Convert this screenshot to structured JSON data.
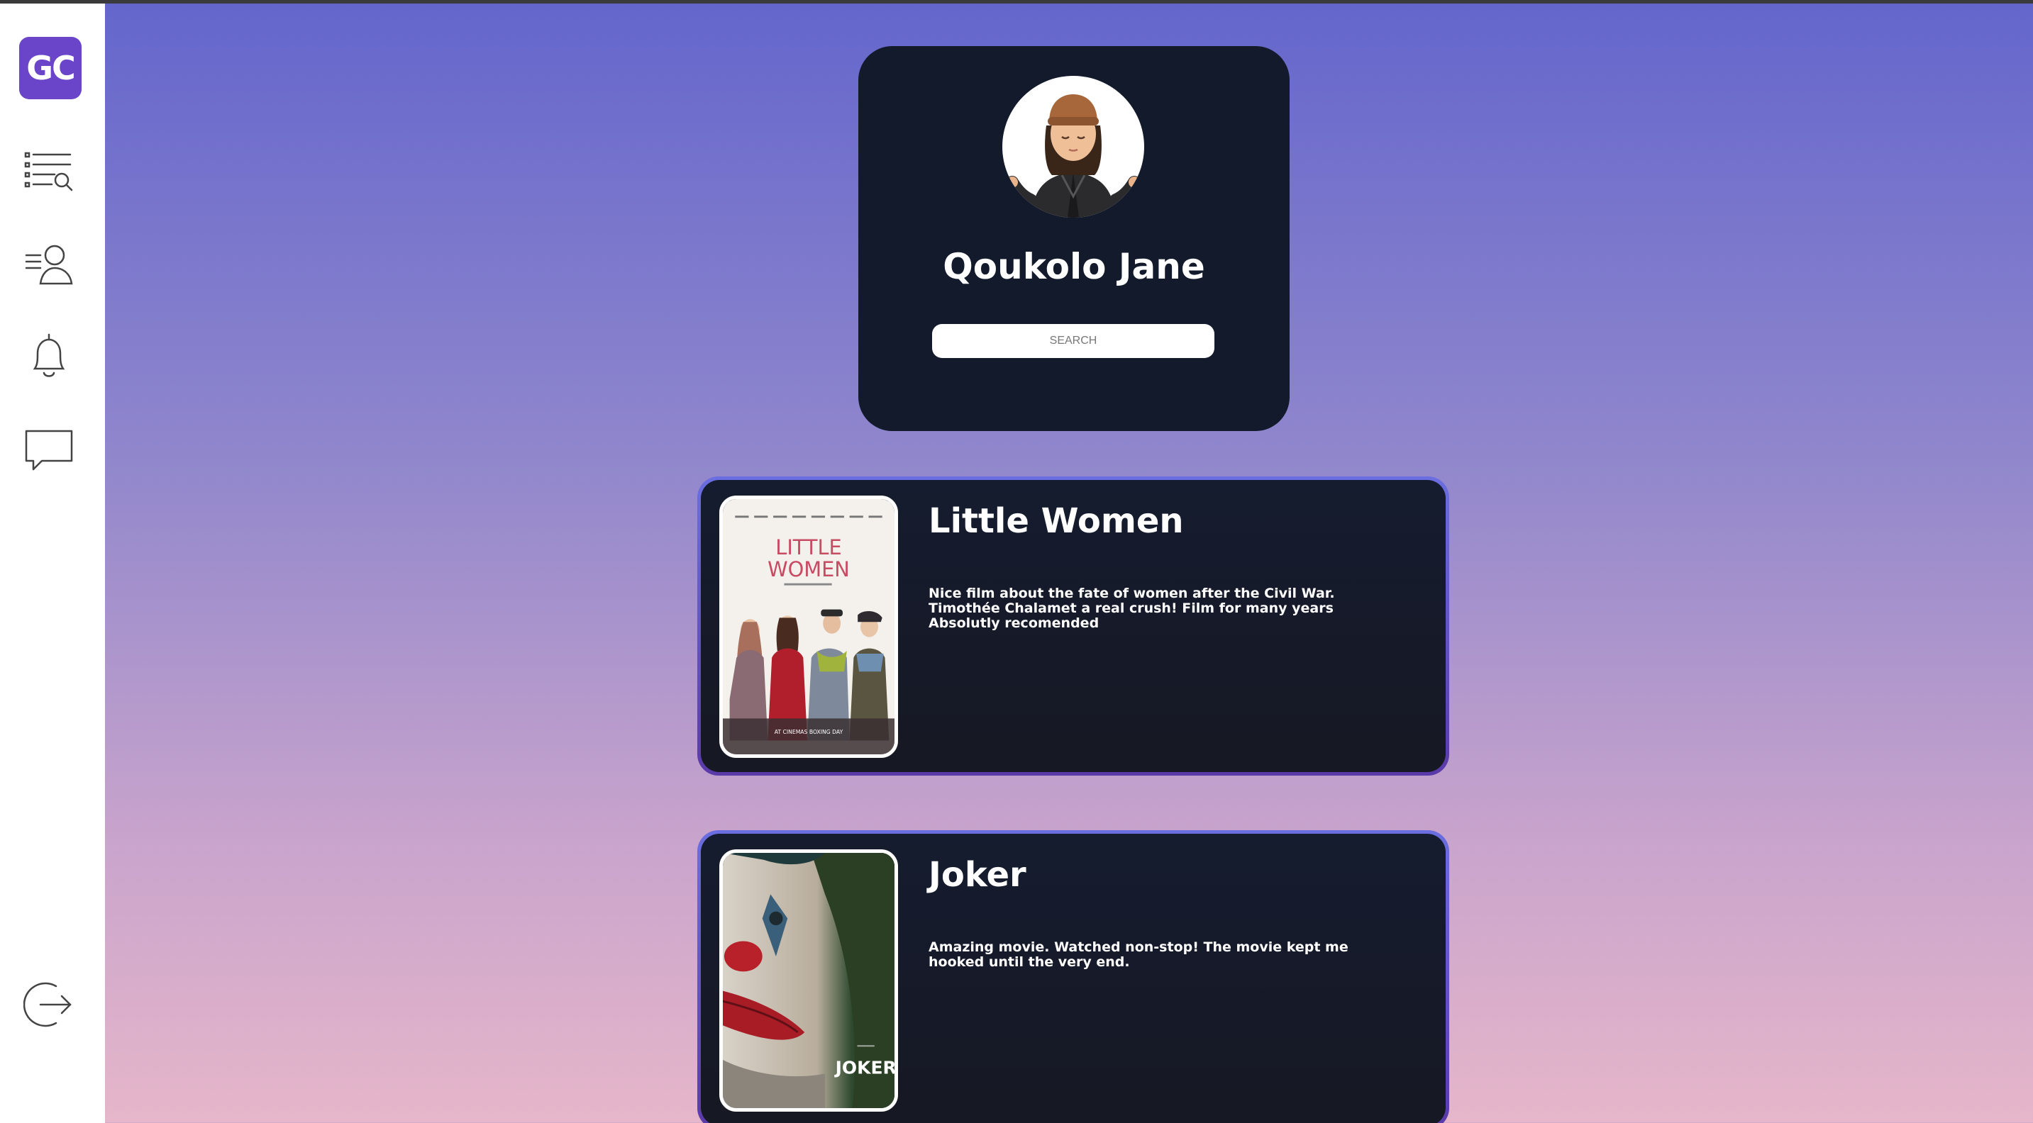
{
  "app": {
    "logo_text": "GC"
  },
  "sidebar": {
    "items": [
      {
        "icon": "list-search-icon"
      },
      {
        "icon": "profile-list-icon"
      },
      {
        "icon": "bell-icon"
      },
      {
        "icon": "chat-icon"
      }
    ],
    "logout_icon": "logout-icon"
  },
  "profile": {
    "name": "Qoukolo Jane",
    "avatar_icon": "memoji-avatar",
    "search": {
      "placeholder": "SEARCH",
      "value": ""
    }
  },
  "movies": [
    {
      "title": "Little Women",
      "review": "Nice film about the fate of women after the Civil War. Timothée Chalamet a real crush! Film for many years Absolutly recomended",
      "poster": {
        "title_line1": "LITTLE",
        "title_line2": "WOMEN",
        "tagline": "AT CINEMAS BOXING DAY"
      }
    },
    {
      "title": "Joker",
      "review": "Amazing movie. Watched non-stop! The movie kept me hooked until the very end.",
      "poster": {
        "title": "JOKER"
      }
    }
  ],
  "colors": {
    "accent": "#6a45c9",
    "card_bg": "#121a2b",
    "bg_top": "#6466cc",
    "bg_bottom": "#e6b6ca"
  }
}
